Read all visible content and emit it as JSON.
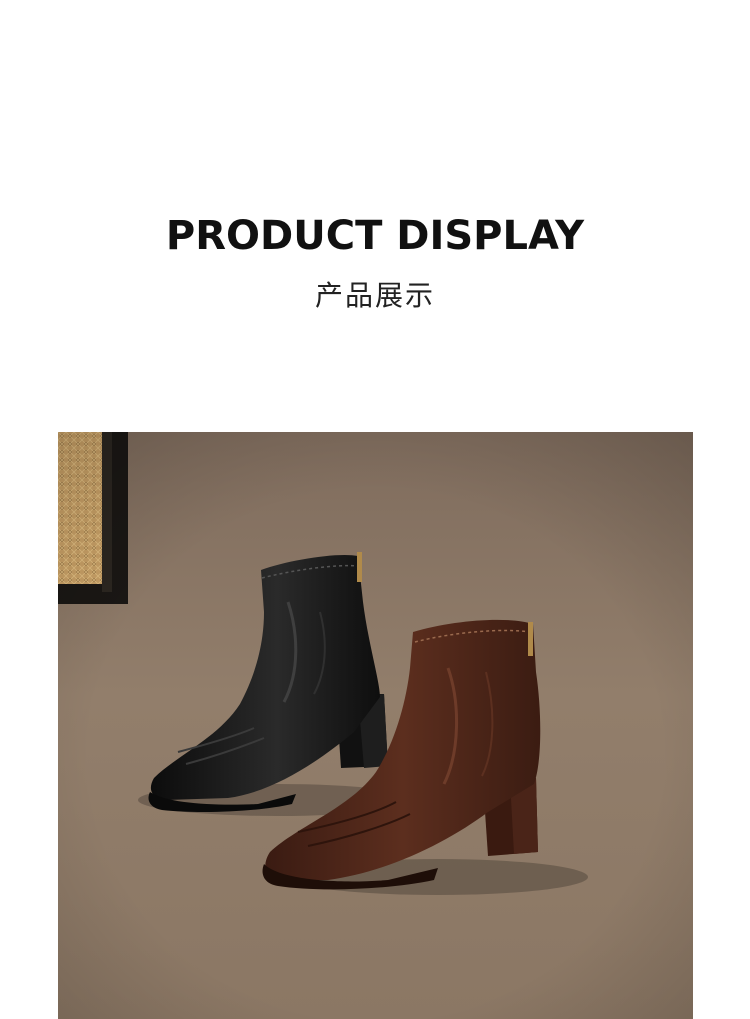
{
  "header": {
    "title": "PRODUCT DISPLAY",
    "subtitle": "产品展示"
  },
  "photo": {
    "subject": "boots-photo",
    "colors": {
      "carpet": "#8f7b68",
      "black_boot": "#141414",
      "brown_boot": "#4a2418"
    }
  }
}
